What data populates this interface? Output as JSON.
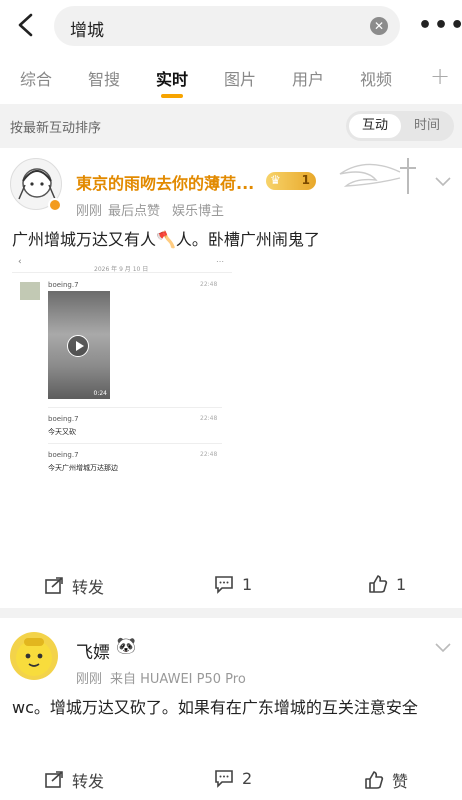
{
  "search": {
    "query": "增城"
  },
  "tabs": [
    "综合",
    "智搜",
    "实时",
    "图片",
    "用户",
    "视频"
  ],
  "sort": {
    "label": "按最新互动排序",
    "options": [
      "互动",
      "时间"
    ]
  },
  "posts": [
    {
      "username": "東京的雨吻去你的薄荷...",
      "vip_badge": "1",
      "time": "刚刚",
      "source": "最后点赞",
      "tag": "娱乐博主",
      "text": "广州增城万达又有人🪓人。卧槽广州闹鬼了",
      "embedded": {
        "header_date": "2026 年 9 月 10 日",
        "messages": [
          {
            "sender": "boeing.7",
            "time": "22:48",
            "text": ""
          },
          {
            "sender": "",
            "time": "",
            "text": "",
            "video_duration": "0:24"
          },
          {
            "sender": "boeing.7",
            "time": "22:48",
            "text": "今天又砍"
          },
          {
            "sender": "boeing.7",
            "time": "22:48",
            "text": "今天广州增城万达那边"
          }
        ]
      },
      "actions": {
        "repost": "转发",
        "comments": "1",
        "likes": "1"
      }
    },
    {
      "username": "飞嫖",
      "time": "刚刚",
      "source": "来自 HUAWEI P50 Pro",
      "text": "wc。增城万达又砍了。如果有在广东增城的互关注意安全",
      "actions": {
        "repost": "转发",
        "comments": "2",
        "likes": "赞"
      }
    }
  ],
  "colors": {
    "accent": "#f7a400",
    "username_vip": "#e28a00",
    "username_normal": "#222222",
    "divider": "#f2f2f2"
  }
}
